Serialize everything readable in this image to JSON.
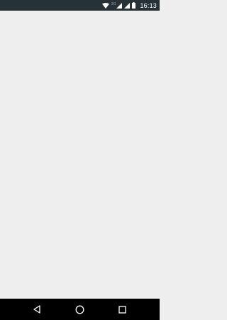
{
  "status_bar": {
    "time": "16:13",
    "network_type": "3G",
    "icons": [
      "wifi-icon",
      "signal-icon",
      "signal-icon",
      "battery-icon"
    ],
    "background_color": "#263238"
  },
  "content": {
    "background_color": "#eeeeee"
  },
  "nav_bar": {
    "buttons": [
      "back-icon",
      "home-icon",
      "recents-icon"
    ],
    "background_color": "#000000"
  }
}
